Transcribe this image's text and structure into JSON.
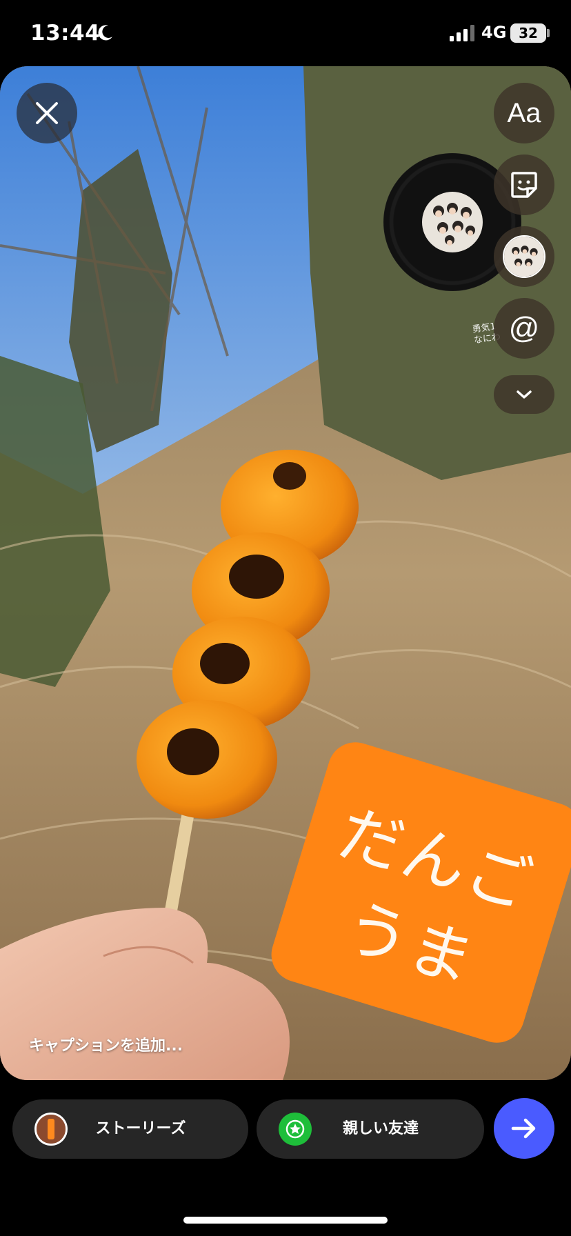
{
  "status_bar": {
    "time": "13:44",
    "network": "4G",
    "battery": "32"
  },
  "editor": {
    "text_sticker": {
      "line1": "だんご",
      "line2": "うま",
      "color": "#ff8514"
    },
    "music_caption": {
      "line1": "勇気1",
      "line2": "なにわ"
    },
    "tools": {
      "text_tool": "Aa",
      "mention_tool": "@"
    },
    "caption_placeholder": "キャプションを追加..."
  },
  "share_bar": {
    "stories_label": "ストーリーズ",
    "close_friends_label": "親しい友達",
    "send_color": "#4a5bff"
  },
  "icons": [
    "moon-icon",
    "signal-icon",
    "close-icon",
    "sticker-icon",
    "music-icon",
    "chevron-down-icon",
    "star-icon",
    "arrow-right-icon"
  ]
}
